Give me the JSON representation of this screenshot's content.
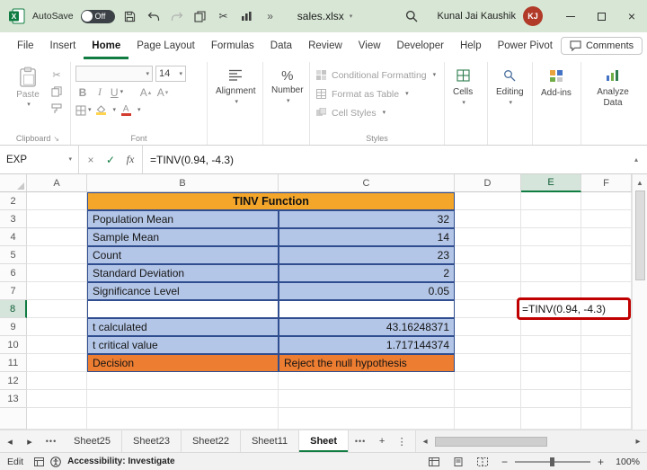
{
  "colors": {
    "accent_green": "#107C41",
    "titlebar_green": "#D8E7D5",
    "table_blue": "#B4C6E7",
    "table_border_blue": "#2F4D8F",
    "title_row_orange": "#F4A62B",
    "decision_row_orange": "#ED7D31",
    "highlight_red": "#C00000",
    "avatar_red": "#B13A29"
  },
  "titlebar": {
    "autosave_label": "AutoSave",
    "autosave_state": "Off",
    "filename": "sales.xlsx",
    "user_name": "Kunal Jai Kaushik",
    "user_initials": "KJ"
  },
  "menu": {
    "items": [
      "File",
      "Insert",
      "Home",
      "Page Layout",
      "Formulas",
      "Data",
      "Review",
      "View",
      "Developer",
      "Help",
      "Power Pivot"
    ],
    "active_item": "Home",
    "comments_label": "Comments"
  },
  "ribbon": {
    "clipboard": {
      "paste_label": "Paste",
      "group_label": "Clipboard"
    },
    "font": {
      "group_label": "Font",
      "size_value": "14",
      "bold_label": "B",
      "italic_label": "I",
      "underline_label": "U"
    },
    "alignment": {
      "group_label": "Alignment"
    },
    "number": {
      "group_label": "Number",
      "icon_text": "%"
    },
    "styles": {
      "group_label": "Styles",
      "conditional_formatting_label": "Conditional Formatting",
      "format_as_table_label": "Format as Table",
      "cell_styles_label": "Cell Styles"
    },
    "cells": {
      "group_label": "Cells"
    },
    "editing": {
      "group_label": "Editing"
    },
    "addins": {
      "group_label": "Add-ins"
    },
    "analyze": {
      "group_label": "Analyze Data"
    }
  },
  "formula_bar": {
    "name_box_value": "EXP",
    "fx_label": "fx",
    "formula": "=TINV(0.94, -4.3)"
  },
  "grid": {
    "column_letters": [
      "A",
      "B",
      "C",
      "D",
      "E",
      "F"
    ],
    "row_numbers": [
      "2",
      "3",
      "4",
      "5",
      "6",
      "7",
      "8",
      "9",
      "10",
      "11",
      "12",
      "13"
    ],
    "selected_column": "E",
    "selected_row": "8",
    "active_cell_formula": "=TINV(0.94, -4.3)",
    "table": {
      "title": "TINV Function",
      "rows": [
        {
          "label": "Population Mean",
          "value": "32"
        },
        {
          "label": "Sample Mean",
          "value": "14"
        },
        {
          "label": "Count",
          "value": "23"
        },
        {
          "label": "Standard Deviation",
          "value": "2"
        },
        {
          "label": "Significance Level",
          "value": "0.05"
        }
      ],
      "results": [
        {
          "label": "t calculated",
          "value": "43.16248371"
        },
        {
          "label": "t critical value",
          "value": "1.717144374"
        }
      ],
      "decision": {
        "label": "Decision",
        "value": "Reject the null hypothesis"
      }
    }
  },
  "sheet_tabs": {
    "tabs": [
      "Sheet25",
      "Sheet23",
      "Sheet22",
      "Sheet11"
    ],
    "active_tab": "Sheet"
  },
  "status_bar": {
    "mode": "Edit",
    "accessibility_label": "Accessibility: Investigate",
    "zoom_level": "100%"
  }
}
